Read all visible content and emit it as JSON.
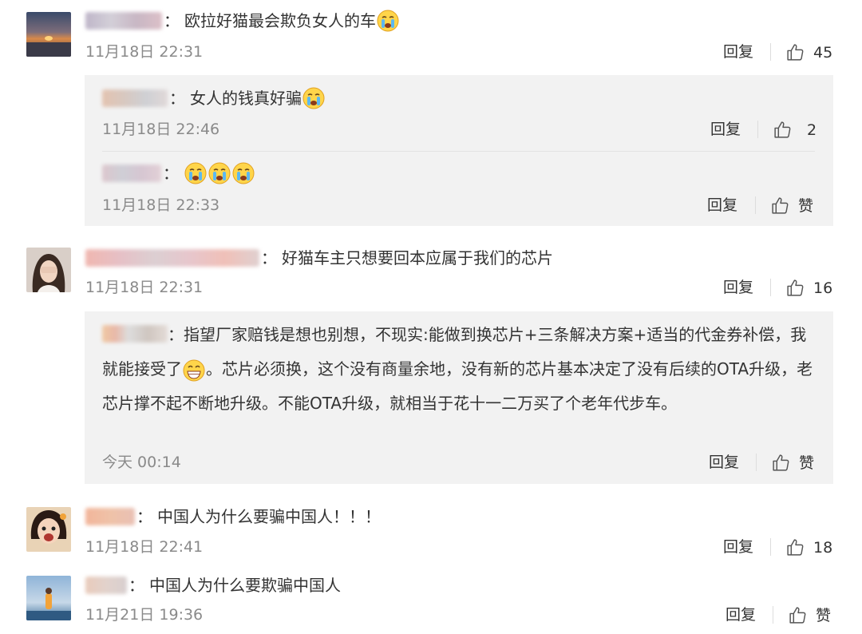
{
  "comments": [
    {
      "text": "欧拉好猫最会欺负女人的车",
      "emoji": "crying-face",
      "time": "11月18日 22:31",
      "reply": "回复",
      "likes": "45",
      "sub": [
        {
          "text": "女人的钱真好骗",
          "emoji": "crying-face",
          "time": "11月18日 22:46",
          "reply": "回复",
          "likes": "2"
        },
        {
          "text": "",
          "emoji": "crying-face x3",
          "time": "11月18日 22:33",
          "reply": "回复",
          "likes": "赞"
        }
      ]
    },
    {
      "text": "好猫车主只想要回本应属于我们的芯片",
      "time": "11月18日 22:31",
      "reply": "回复",
      "likes": "16",
      "sub": [
        {
          "text_before": "指望厂家赔钱是想也别想，不现实:能做到换芯片+三条解决方案+适当的代金券补偿，我就能接受了",
          "emoji": "grinning-face",
          "text_after": "。芯片必须换，这个没有商量余地，没有新的芯片基本决定了没有后续的OTA升级，老芯片撑不起不断地升级。不能OTA升级，就相当于花十一二万买了个老年代步车。",
          "time": "今天 00:14",
          "reply": "回复",
          "likes": "赞"
        }
      ]
    },
    {
      "text": "中国人为什么要骗中国人！！！",
      "time": "11月18日 22:41",
      "reply": "回复",
      "likes": "18"
    },
    {
      "text": "中国人为什么要欺骗中国人",
      "time": "11月21日 19:36",
      "reply": "回复",
      "likes": "赞"
    }
  ],
  "colors": {
    "text": "#333333",
    "time": "#8a8a8a",
    "panel": "#f2f2f2"
  }
}
